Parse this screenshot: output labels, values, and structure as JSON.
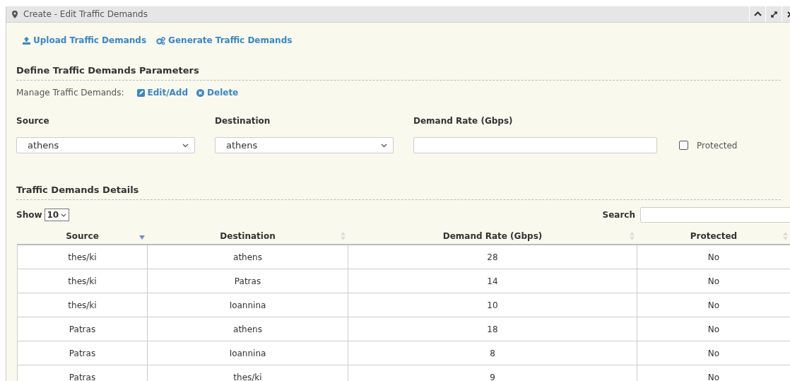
{
  "window": {
    "title": "Create - Edit Traffic Demands"
  },
  "actions": [
    {
      "kind": "upload",
      "label": "Upload Traffic Demands"
    },
    {
      "kind": "generate",
      "label": "Generate Traffic Demands"
    }
  ],
  "parameters": {
    "heading": "Define Traffic Demands Parameters",
    "manage_label": "Manage Traffic Demands:",
    "manage_actions": [
      {
        "kind": "edit",
        "label": "Edit/Add"
      },
      {
        "kind": "delete",
        "label": "Delete"
      }
    ],
    "fields": [
      {
        "kind": "select",
        "label": "Source",
        "value": "athens"
      },
      {
        "kind": "select",
        "label": "Destination",
        "value": "athens"
      },
      {
        "kind": "text",
        "label": "Demand Rate (Gbps)"
      }
    ],
    "protected": {
      "label": "Protected",
      "checked": false
    }
  },
  "details": {
    "heading": "Traffic Demands Details",
    "show_label": "Show",
    "page_size": "10",
    "search_label": "Search",
    "columns": [
      {
        "label": "Source",
        "sorted": true
      },
      {
        "label": "Destination",
        "sorted": false
      },
      {
        "label": "Demand Rate (Gbps)",
        "sorted": false
      },
      {
        "label": "Protected",
        "sorted": false
      }
    ],
    "rows": [
      [
        "thes/ki",
        "athens",
        "28",
        "No"
      ],
      [
        "thes/ki",
        "Patras",
        "14",
        "No"
      ],
      [
        "thes/ki",
        "Ioannina",
        "10",
        "No"
      ],
      [
        "Patras",
        "athens",
        "18",
        "No"
      ],
      [
        "Patras",
        "Ioannina",
        "8",
        "No"
      ],
      [
        "Patras",
        "thes/ki",
        "9",
        "No"
      ]
    ]
  }
}
